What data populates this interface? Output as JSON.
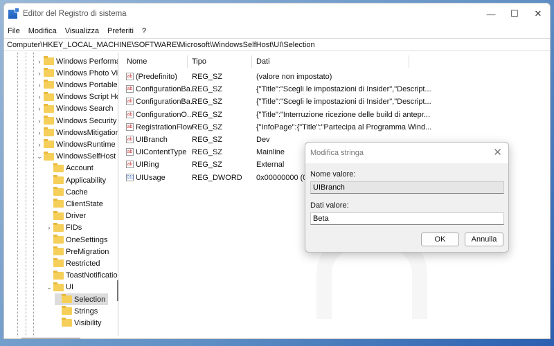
{
  "window": {
    "title": "Editor del Registro di sistema",
    "minimize": "—",
    "maximize": "☐",
    "close": "✕"
  },
  "menu": [
    "File",
    "Modifica",
    "Visualizza",
    "Preferiti",
    "?"
  ],
  "address": "Computer\\HKEY_LOCAL_MACHINE\\SOFTWARE\\Microsoft\\WindowsSelfHost\\UI\\Selection",
  "tree": [
    {
      "label": "Windows Performa",
      "level": 1,
      "chev": ">"
    },
    {
      "label": "Windows Photo Vie",
      "level": 1,
      "chev": ">"
    },
    {
      "label": "Windows Portable I",
      "level": 1,
      "chev": ">"
    },
    {
      "label": "Windows Script Ho",
      "level": 1,
      "chev": ">"
    },
    {
      "label": "Windows Search",
      "level": 1,
      "chev": ">"
    },
    {
      "label": "Windows Security H",
      "level": 1,
      "chev": ">"
    },
    {
      "label": "WindowsMitigation",
      "level": 1,
      "chev": ">"
    },
    {
      "label": "WindowsRuntime",
      "level": 1,
      "chev": ">"
    },
    {
      "label": "WindowsSelfHost",
      "level": 1,
      "chev": "v"
    },
    {
      "label": "Account",
      "level": 2,
      "chev": ""
    },
    {
      "label": "Applicability",
      "level": 2,
      "chev": ""
    },
    {
      "label": "Cache",
      "level": 2,
      "chev": ""
    },
    {
      "label": "ClientState",
      "level": 2,
      "chev": ""
    },
    {
      "label": "Driver",
      "level": 2,
      "chev": ""
    },
    {
      "label": "FIDs",
      "level": 2,
      "chev": ">"
    },
    {
      "label": "OneSettings",
      "level": 2,
      "chev": ""
    },
    {
      "label": "PreMigration",
      "level": 2,
      "chev": ""
    },
    {
      "label": "Restricted",
      "level": 2,
      "chev": ""
    },
    {
      "label": "ToastNotification",
      "level": 2,
      "chev": ""
    },
    {
      "label": "UI",
      "level": 2,
      "chev": "v"
    },
    {
      "label": "Selection",
      "level": 3,
      "chev": "",
      "selected": true
    },
    {
      "label": "Strings",
      "level": 3,
      "chev": ""
    },
    {
      "label": "Visibility",
      "level": 3,
      "chev": ""
    }
  ],
  "columns": {
    "name": "Nome",
    "type": "Tipo",
    "data": "Dati"
  },
  "values": [
    {
      "icon": "ab",
      "name": "(Predefinito)",
      "type": "REG_SZ",
      "data": "(valore non impostato)"
    },
    {
      "icon": "ab",
      "name": "ConfigurationBa...",
      "type": "REG_SZ",
      "data": "{\"Title\":\"Scegli le impostazioni di Insider\",\"Descript..."
    },
    {
      "icon": "ab",
      "name": "ConfigurationBa...",
      "type": "REG_SZ",
      "data": "{\"Title\":\"Scegli le impostazioni di Insider\",\"Descript..."
    },
    {
      "icon": "ab",
      "name": "ConfigurationO...",
      "type": "REG_SZ",
      "data": "{\"Title\":\"Interruzione ricezione delle build di antepr..."
    },
    {
      "icon": "ab",
      "name": "RegistrationFlow",
      "type": "REG_SZ",
      "data": "{\"InfoPage\":{\"Title\":\"Partecipa al Programma Wind..."
    },
    {
      "icon": "ab",
      "name": "UIBranch",
      "type": "REG_SZ",
      "data": "Dev"
    },
    {
      "icon": "ab",
      "name": "UIContentType",
      "type": "REG_SZ",
      "data": "Mainline"
    },
    {
      "icon": "ab",
      "name": "UIRing",
      "type": "REG_SZ",
      "data": "External"
    },
    {
      "icon": "011",
      "name": "UIUsage",
      "type": "REG_DWORD",
      "data": "0x00000000 (0)"
    }
  ],
  "dialog": {
    "title": "Modifica stringa",
    "close": "✕",
    "name_label": "Nome valore:",
    "name_value": "UIBranch",
    "data_label": "Dati valore:",
    "data_value": "Beta",
    "ok": "OK",
    "cancel": "Annulla"
  }
}
